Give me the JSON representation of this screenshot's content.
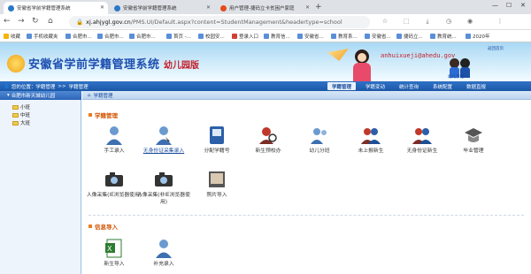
{
  "browser": {
    "tabs": [
      {
        "label": "安徽省学前学籍管理系统",
        "active": true
      },
      {
        "label": "安徽省学前学籍管理系统",
        "active": false
      },
      {
        "label": "用户管理-捷码立卡贫困户家庭",
        "active": false
      }
    ],
    "url_host": "xj.ahjygl.gov.cn",
    "url_path": "/PMS.UI/Default.aspx?content=StudentManagement&headertype=school"
  },
  "bookmarks": [
    "收藏",
    "手机收藏夹",
    "合肥市...",
    "合肥市...",
    "合肥市...",
    "首页 -...",
    "校园安...",
    "登录入口",
    "教育信...",
    "安徽省...",
    "教育系...",
    "安徽省...",
    "捷码立...",
    "教育统...",
    "2020年"
  ],
  "banner": {
    "title": "安徽省学前学籍管理系统",
    "subtitle": "幼儿园版",
    "email": "anhuixueji@ahedu.gov",
    "links": "返回首页",
    "kids_label": "幼儿学籍"
  },
  "breadcrumb": {
    "prefix": "您的位置：",
    "item1": "学籍管理",
    "sep": ">>",
    "item2": "学籍管理"
  },
  "menu": [
    {
      "label": "学籍管理",
      "active": true
    },
    {
      "label": "学籍变动"
    },
    {
      "label": "统计查询"
    },
    {
      "label": "系统配置"
    },
    {
      "label": "数据直报"
    }
  ],
  "sidebar": {
    "root": "合肥市新天城幼儿园",
    "nodes": [
      "小班",
      "中班",
      "大班"
    ]
  },
  "content": {
    "header": "学籍管理",
    "section1": "学籍管理",
    "items1": [
      "手工录入",
      "无身份证采集录入",
      "分配学籍号",
      "新生预校办",
      "幼儿分班",
      "未上报新生",
      "无身份证新生",
      "毕业管理"
    ],
    "items2": [
      "人像采集(IE浏览器使用)",
      "人像采集(非IE浏览器使用)",
      "照片导入"
    ],
    "section2": "信息导入",
    "items3": [
      "新生导入",
      "补充录入"
    ]
  }
}
